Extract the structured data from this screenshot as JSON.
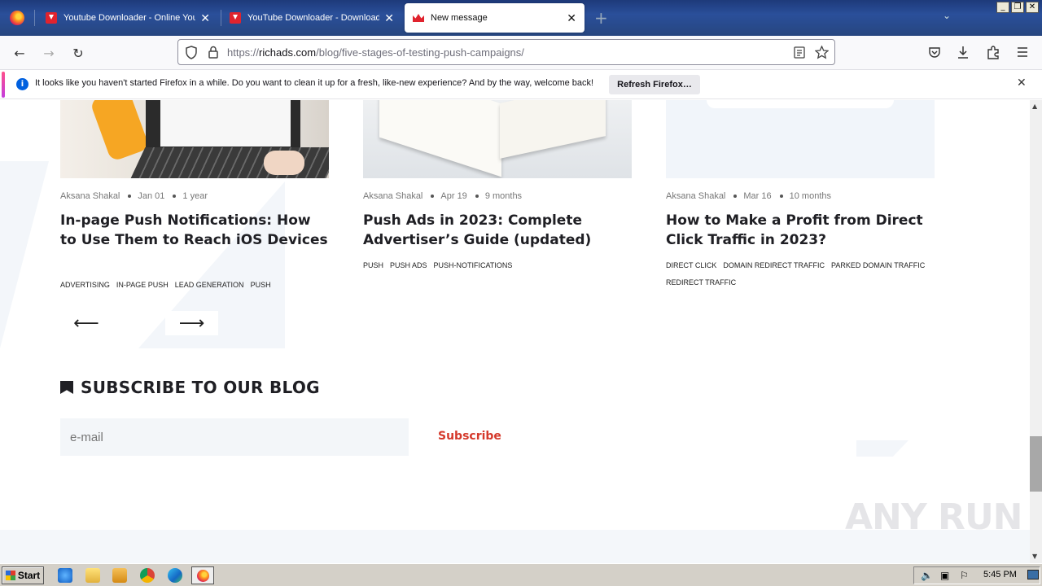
{
  "browser": {
    "tabs": [
      {
        "title": "Youtube Downloader - Online Youtu",
        "icon": "youtube-downloader-icon"
      },
      {
        "title": "YouTube Downloader - Download Y",
        "icon": "download-icon"
      },
      {
        "title": "New message",
        "icon": "richads-crown-icon",
        "active": true
      }
    ],
    "url_prefix": "https://",
    "url_domain": "richads.com",
    "url_path": "/blog/five-stages-of-testing-push-campaigns/"
  },
  "notification": {
    "message": "It looks like you haven't started Firefox in a while. Do you want to clean it up for a fresh, like-new experience? And by the way, welcome back!",
    "button": "Refresh Firefox…"
  },
  "posts": [
    {
      "author": "Aksana Shakal",
      "date": "Jan 01",
      "age": "1 year",
      "title": "In-page Push Notifications: How to Use Them to Reach iOS Devices",
      "tags": [
        "advertising",
        "in-page push",
        "lead generation",
        "push"
      ]
    },
    {
      "author": "Aksana Shakal",
      "date": "Apr 19",
      "age": "9 months",
      "title": "Push Ads in 2023: Complete Advertiser’s Guide (updated)",
      "tags": [
        "push",
        "push ads",
        "push-notifications"
      ]
    },
    {
      "author": "Aksana Shakal",
      "date": "Mar 16",
      "age": "10 months",
      "title": "How to Make a Profit from Direct Click Traffic in 2023?",
      "tags": [
        "direct click",
        "domain redirect traffic",
        "parked domain traffic",
        "redirect traffic"
      ]
    }
  ],
  "subscribe": {
    "heading": "SUBSCRIBE TO OUR BLOG",
    "placeholder": "e-mail",
    "button": "Subscribe"
  },
  "watermark": "ANY RUN",
  "taskbar": {
    "start": "Start",
    "clock": "5:45 PM"
  },
  "colors": {
    "accent_red": "#d5392b",
    "firefox_blue": "#0060df"
  }
}
